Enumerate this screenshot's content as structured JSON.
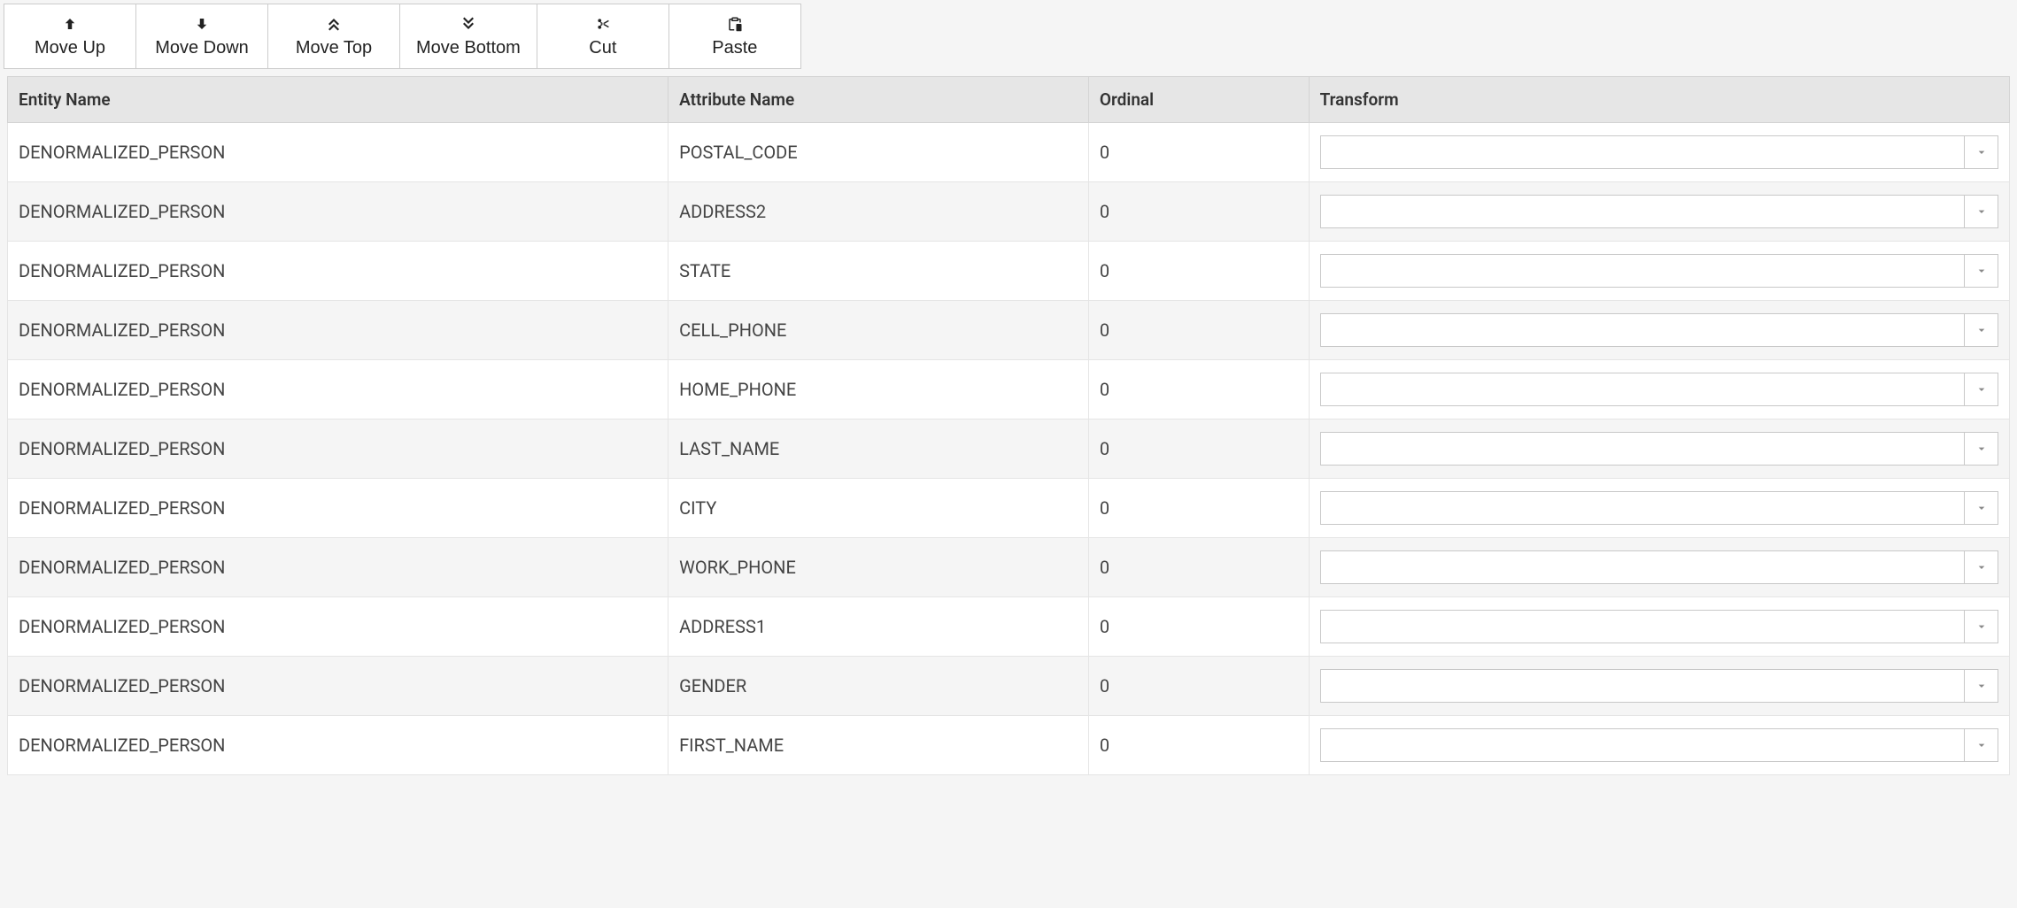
{
  "toolbar": {
    "move_up": "Move Up",
    "move_down": "Move Down",
    "move_top": "Move Top",
    "move_bottom": "Move Bottom",
    "cut": "Cut",
    "paste": "Paste"
  },
  "table": {
    "headers": {
      "entity_name": "Entity Name",
      "attribute_name": "Attribute Name",
      "ordinal": "Ordinal",
      "transform": "Transform"
    },
    "rows": [
      {
        "entity": "DENORMALIZED_PERSON",
        "attribute": "POSTAL_CODE",
        "ordinal": "0",
        "transform": ""
      },
      {
        "entity": "DENORMALIZED_PERSON",
        "attribute": "ADDRESS2",
        "ordinal": "0",
        "transform": ""
      },
      {
        "entity": "DENORMALIZED_PERSON",
        "attribute": "STATE",
        "ordinal": "0",
        "transform": ""
      },
      {
        "entity": "DENORMALIZED_PERSON",
        "attribute": "CELL_PHONE",
        "ordinal": "0",
        "transform": ""
      },
      {
        "entity": "DENORMALIZED_PERSON",
        "attribute": "HOME_PHONE",
        "ordinal": "0",
        "transform": ""
      },
      {
        "entity": "DENORMALIZED_PERSON",
        "attribute": "LAST_NAME",
        "ordinal": "0",
        "transform": ""
      },
      {
        "entity": "DENORMALIZED_PERSON",
        "attribute": "CITY",
        "ordinal": "0",
        "transform": ""
      },
      {
        "entity": "DENORMALIZED_PERSON",
        "attribute": "WORK_PHONE",
        "ordinal": "0",
        "transform": ""
      },
      {
        "entity": "DENORMALIZED_PERSON",
        "attribute": "ADDRESS1",
        "ordinal": "0",
        "transform": ""
      },
      {
        "entity": "DENORMALIZED_PERSON",
        "attribute": "GENDER",
        "ordinal": "0",
        "transform": ""
      },
      {
        "entity": "DENORMALIZED_PERSON",
        "attribute": "FIRST_NAME",
        "ordinal": "0",
        "transform": ""
      }
    ]
  }
}
